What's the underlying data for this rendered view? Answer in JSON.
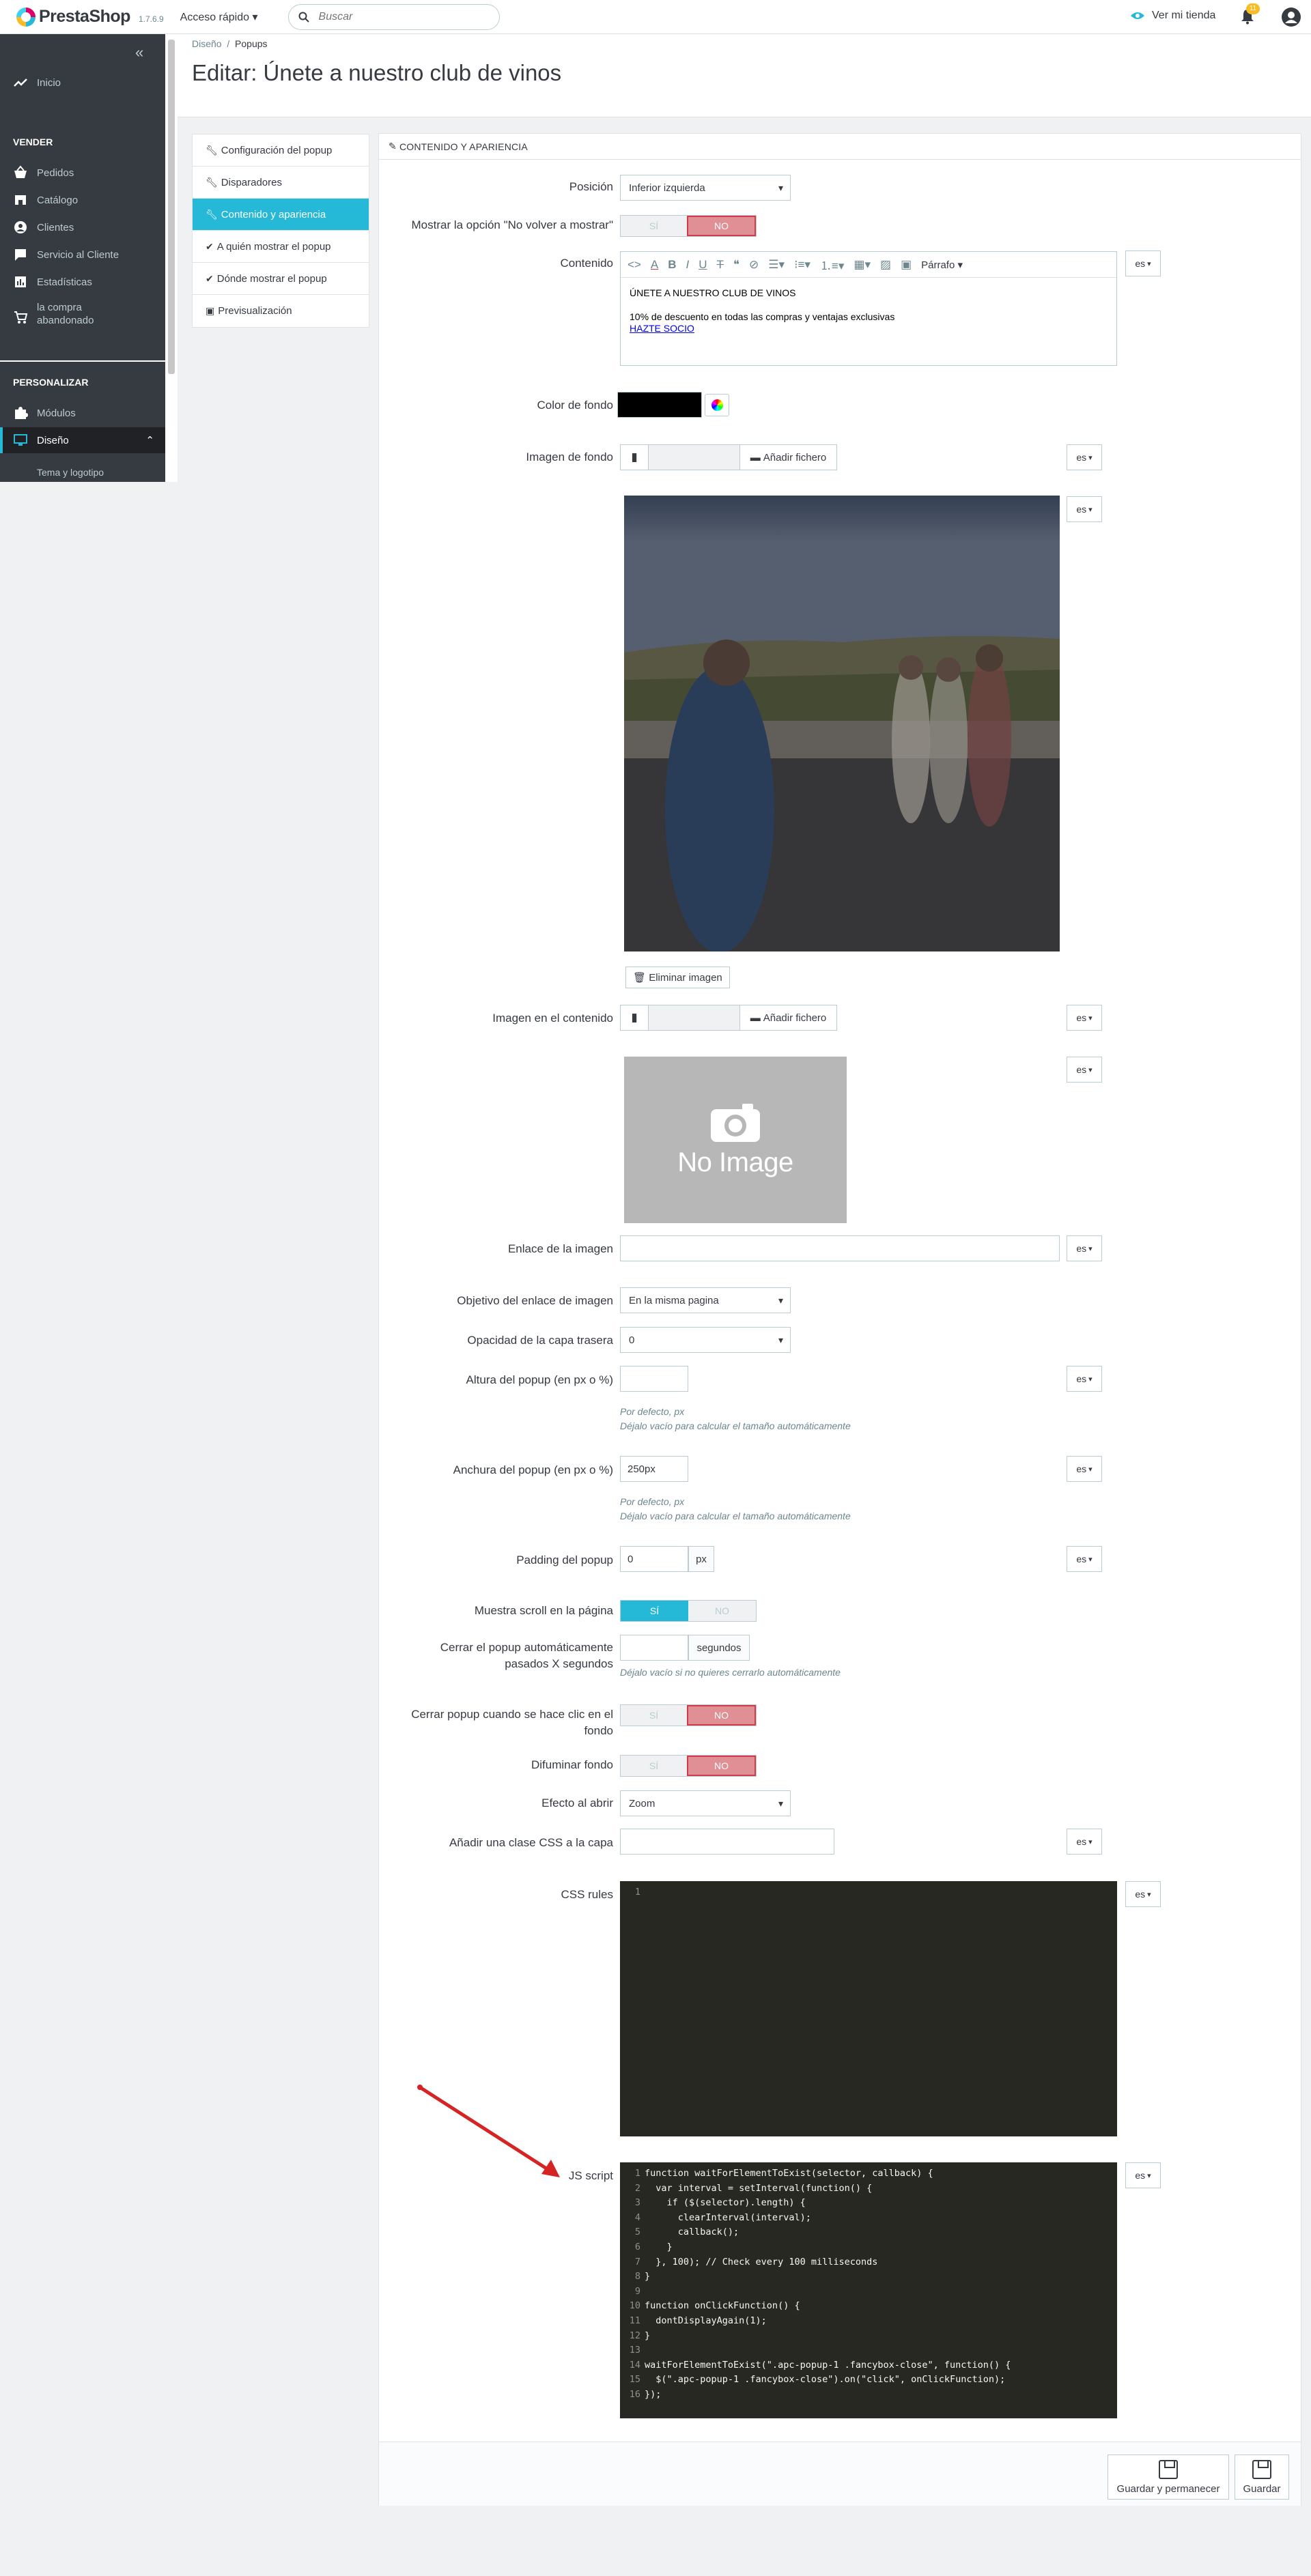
{
  "topbar": {
    "logo": "PrestaShop",
    "version": "1.7.6.9",
    "quick_access": "Acceso rápido",
    "search_placeholder": "Buscar",
    "view_shop": "Ver mi tienda",
    "notifications_count": "11"
  },
  "sidebar": {
    "home": "Inicio",
    "section_sell": "VENDER",
    "orders": "Pedidos",
    "catalog": "Catálogo",
    "customers": "Clientes",
    "customer_service": "Servicio al Cliente",
    "stats": "Estadísticas",
    "abandoned": "la compra abandonado",
    "section_customize": "PERSONALIZAR",
    "modules": "Módulos",
    "design": "Diseño",
    "theme_logo": "Tema y logotipo"
  },
  "breadcrumb": {
    "parent": "Diseño",
    "separator": "/",
    "current": "Popups"
  },
  "page_title": "Editar: Únete a nuestro club de vinos",
  "tabs": [
    {
      "label": "Configuración del popup",
      "icon": "wrench-icon"
    },
    {
      "label": "Disparadores",
      "icon": "wrench-icon"
    },
    {
      "label": "Contenido y apariencia",
      "icon": "wrench-icon"
    },
    {
      "label": "A quién mostrar el popup",
      "icon": "check-icon"
    },
    {
      "label": "Dónde mostrar el popup",
      "icon": "check-icon"
    },
    {
      "label": "Previsualización",
      "icon": "image-icon"
    }
  ],
  "panel": {
    "title": "CONTENIDO Y APARIENCIA",
    "position_label": "Posición",
    "position_value": "Inferior izquierda",
    "no_show_label": "Mostrar la opción \"No volver a mostrar\"",
    "yes": "SÍ",
    "no": "NO",
    "content_label": "Contenido",
    "editor_paragraph": "Párrafo",
    "editor_line1": "ÚNETE A NUESTRO CLUB DE VINOS",
    "editor_line2": "10% de descuento en todas las compras y ventajas exclusivas",
    "editor_link": "HAZTE SOCIO",
    "lang": "es",
    "bg_color_label": "Color de fondo",
    "bg_color_value": "#000000",
    "bg_image_label": "Imagen de fondo",
    "add_file": "Añadir fichero",
    "delete_image": "Eliminar imagen",
    "content_image_label": "Imagen en el contenido",
    "no_image": "No Image",
    "image_link_label": "Enlace de la imagen",
    "image_target_label": "Objetivo del enlace de imagen",
    "image_target_value": "En la misma pagina",
    "overlay_opacity_label": "Opacidad de la capa trasera",
    "overlay_opacity_value": "0",
    "height_label": "Altura del popup (en px o %)",
    "height_value": "",
    "help_default_px": "Por defecto, px",
    "help_auto_size": "Déjalo vacío para calcular el tamaño automáticamente",
    "width_label": "Anchura del popup (en px o %)",
    "width_value": "250px",
    "padding_label": "Padding del popup",
    "padding_value": "0",
    "padding_unit": "px",
    "scroll_label": "Muestra scroll en la página",
    "autoclose_label": "Cerrar el popup automáticamente pasados X segundos",
    "autoclose_unit": "segundos",
    "autoclose_help": "Déjalo vacío si no quieres cerrarlo automáticamente",
    "close_bg_label": "Cerrar popup cuando se hace clic en el fondo",
    "blur_label": "Difuminar fondo",
    "effect_label": "Efecto al abrir",
    "effect_value": "Zoom",
    "css_class_label": "Añadir una clase CSS a la capa",
    "css_rules_label": "CSS rules",
    "js_label": "JS script"
  },
  "css_code": [
    "1"
  ],
  "js_code": [
    "function waitForElementToExist(selector, callback) {",
    "  var interval = setInterval(function() {",
    "    if ($(selector).length) {",
    "      clearInterval(interval);",
    "      callback();",
    "    }",
    "  }, 100); // Check every 100 milliseconds",
    "}",
    "",
    "function onClickFunction() {",
    "  dontDisplayAgain(1);",
    "}",
    "",
    "waitForElementToExist(\".apc-popup-1 .fancybox-close\", function() {",
    "  $(\".apc-popup-1 .fancybox-close\").on(\"click\", onClickFunction);",
    "});"
  ],
  "footer": {
    "save_stay": "Guardar y permanecer",
    "save": "Guardar"
  },
  "colors": {
    "accent": "#25b9d7",
    "danger": "#cd3c48",
    "sidebar": "#363a41",
    "code_bg": "#272822",
    "annotation_arrow": "#d62424"
  }
}
